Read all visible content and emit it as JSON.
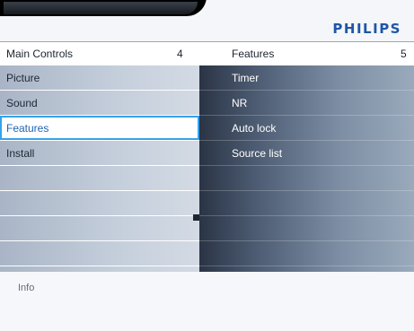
{
  "brand": "PHILIPS",
  "header": {
    "left_title": "Main Controls",
    "left_number": "4",
    "right_title": "Features",
    "right_number": "5"
  },
  "main_controls": [
    "Picture",
    "Sound",
    "Features",
    "Install"
  ],
  "selected_item": "Features",
  "features": [
    "Timer",
    "NR",
    "Auto lock",
    "Source list"
  ],
  "info_label": "Info",
  "colors": {
    "brand": "#1e56a8",
    "selection_border": "#35a2ec",
    "selected_text": "#1b63b6"
  }
}
